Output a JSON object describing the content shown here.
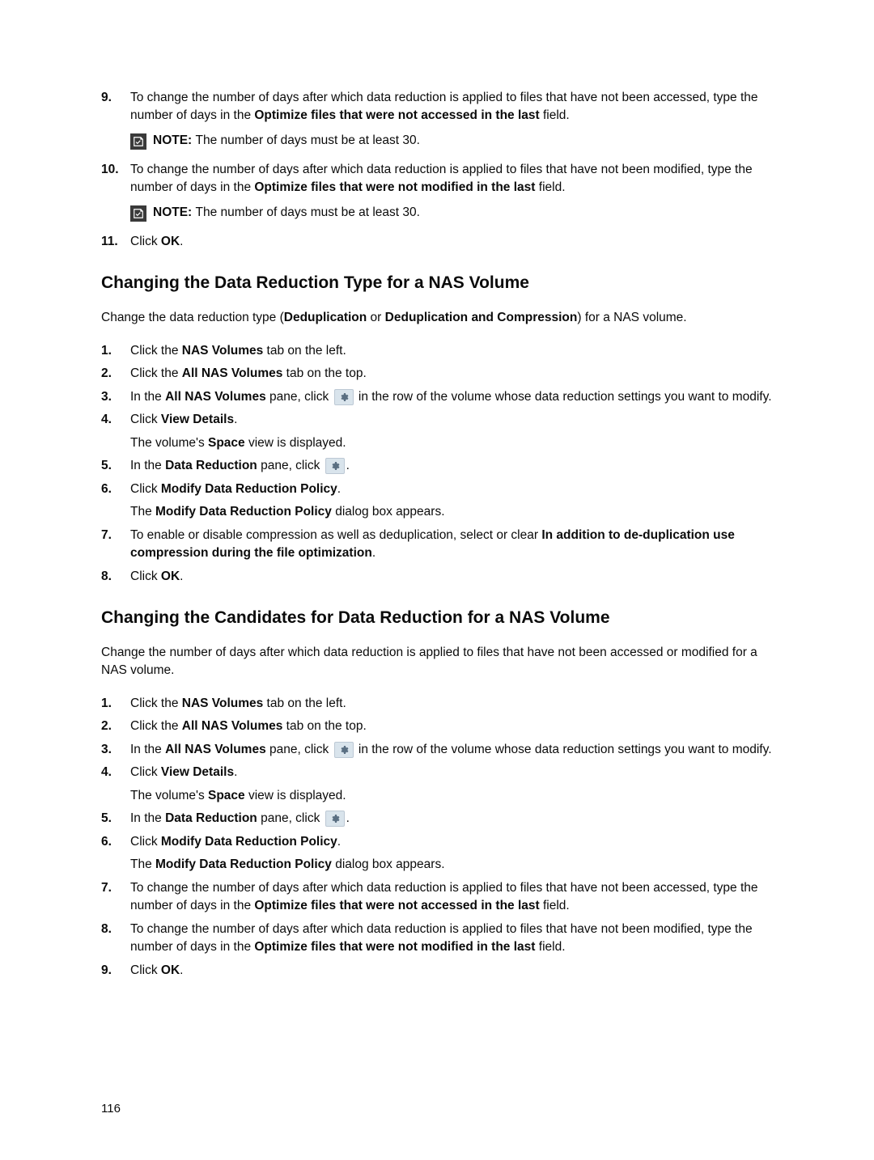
{
  "section_a": {
    "steps": [
      {
        "num": "9.",
        "parts": [
          {
            "t": "To change the number of days after which data reduction is applied to files that have not been accessed, type the number of days in the "
          },
          {
            "t": "Optimize files that were not accessed in the last",
            "b": true
          },
          {
            "t": " field."
          }
        ],
        "note": {
          "label": "NOTE: ",
          "text": "The number of days must be at least 30."
        }
      },
      {
        "num": "10.",
        "parts": [
          {
            "t": "To change the number of days after which data reduction is applied to files that have not been modified, type the number of days in the "
          },
          {
            "t": "Optimize files that were not modified in the last",
            "b": true
          },
          {
            "t": " field."
          }
        ],
        "note": {
          "label": "NOTE: ",
          "text": "The number of days must be at least 30."
        }
      },
      {
        "num": "11.",
        "parts": [
          {
            "t": "Click "
          },
          {
            "t": "OK",
            "b": true
          },
          {
            "t": "."
          }
        ]
      }
    ]
  },
  "section_b": {
    "heading": "Changing the Data Reduction Type for a NAS Volume",
    "intro": [
      {
        "t": "Change the data reduction type ("
      },
      {
        "t": "Deduplication",
        "b": true
      },
      {
        "t": " or "
      },
      {
        "t": "Deduplication and Compression",
        "b": true
      },
      {
        "t": ") for a NAS volume."
      }
    ],
    "steps": [
      {
        "num": "1.",
        "parts": [
          {
            "t": "Click the "
          },
          {
            "t": "NAS Volumes",
            "b": true
          },
          {
            "t": " tab on the left."
          }
        ]
      },
      {
        "num": "2.",
        "parts": [
          {
            "t": "Click the "
          },
          {
            "t": "All NAS Volumes",
            "b": true
          },
          {
            "t": " tab on the top."
          }
        ]
      },
      {
        "num": "3.",
        "parts": [
          {
            "t": "In the "
          },
          {
            "t": "All NAS Volumes",
            "b": true
          },
          {
            "t": " pane, click "
          },
          {
            "icon": true
          },
          {
            "t": " in the row of the volume whose data reduction settings you want to modify."
          }
        ]
      },
      {
        "num": "4.",
        "parts": [
          {
            "t": "Click "
          },
          {
            "t": "View Details",
            "b": true
          },
          {
            "t": "."
          }
        ],
        "after": [
          {
            "t": "The volume's "
          },
          {
            "t": "Space",
            "b": true
          },
          {
            "t": " view is displayed."
          }
        ]
      },
      {
        "num": "5.",
        "parts": [
          {
            "t": "In the "
          },
          {
            "t": "Data Reduction",
            "b": true
          },
          {
            "t": " pane, click "
          },
          {
            "icon": true
          },
          {
            "t": "."
          }
        ]
      },
      {
        "num": "6.",
        "parts": [
          {
            "t": "Click "
          },
          {
            "t": "Modify Data Reduction Policy",
            "b": true
          },
          {
            "t": "."
          }
        ],
        "after": [
          {
            "t": "The "
          },
          {
            "t": "Modify Data Reduction Policy",
            "b": true
          },
          {
            "t": " dialog box appears."
          }
        ]
      },
      {
        "num": "7.",
        "parts": [
          {
            "t": "To enable or disable compression as well as deduplication, select or clear "
          },
          {
            "t": "In addition to de-duplication use compression during the file optimization",
            "b": true
          },
          {
            "t": "."
          }
        ]
      },
      {
        "num": "8.",
        "parts": [
          {
            "t": "Click "
          },
          {
            "t": "OK",
            "b": true
          },
          {
            "t": "."
          }
        ]
      }
    ]
  },
  "section_c": {
    "heading": "Changing the Candidates for Data Reduction for a NAS Volume",
    "intro": [
      {
        "t": "Change the number of days after which data reduction is applied to files that have not been accessed or modified for a NAS volume."
      }
    ],
    "steps": [
      {
        "num": "1.",
        "parts": [
          {
            "t": "Click the "
          },
          {
            "t": "NAS Volumes",
            "b": true
          },
          {
            "t": " tab on the left."
          }
        ]
      },
      {
        "num": "2.",
        "parts": [
          {
            "t": "Click the "
          },
          {
            "t": "All NAS Volumes",
            "b": true
          },
          {
            "t": " tab on the top."
          }
        ]
      },
      {
        "num": "3.",
        "parts": [
          {
            "t": "In the "
          },
          {
            "t": "All NAS Volumes",
            "b": true
          },
          {
            "t": " pane, click "
          },
          {
            "icon": true
          },
          {
            "t": " in the row of the volume whose data reduction settings you want to modify."
          }
        ]
      },
      {
        "num": "4.",
        "parts": [
          {
            "t": "Click "
          },
          {
            "t": "View Details",
            "b": true
          },
          {
            "t": "."
          }
        ],
        "after": [
          {
            "t": "The volume's "
          },
          {
            "t": "Space",
            "b": true
          },
          {
            "t": " view is displayed."
          }
        ]
      },
      {
        "num": "5.",
        "parts": [
          {
            "t": "In the "
          },
          {
            "t": "Data Reduction",
            "b": true
          },
          {
            "t": " pane, click "
          },
          {
            "icon": true
          },
          {
            "t": "."
          }
        ]
      },
      {
        "num": "6.",
        "parts": [
          {
            "t": "Click "
          },
          {
            "t": "Modify Data Reduction Policy",
            "b": true
          },
          {
            "t": "."
          }
        ],
        "after": [
          {
            "t": "The "
          },
          {
            "t": "Modify Data Reduction Policy",
            "b": true
          },
          {
            "t": " dialog box appears."
          }
        ]
      },
      {
        "num": "7.",
        "parts": [
          {
            "t": "To change the number of days after which data reduction is applied to files that have not been accessed, type the number of days in the "
          },
          {
            "t": "Optimize files that were not accessed in the last",
            "b": true
          },
          {
            "t": " field."
          }
        ]
      },
      {
        "num": "8.",
        "parts": [
          {
            "t": "To change the number of days after which data reduction is applied to files that have not been modified, type the number of days in the "
          },
          {
            "t": "Optimize files that were not modified in the last",
            "b": true
          },
          {
            "t": " field."
          }
        ]
      },
      {
        "num": "9.",
        "parts": [
          {
            "t": "Click "
          },
          {
            "t": "OK",
            "b": true
          },
          {
            "t": "."
          }
        ]
      }
    ]
  },
  "page_number": "116"
}
